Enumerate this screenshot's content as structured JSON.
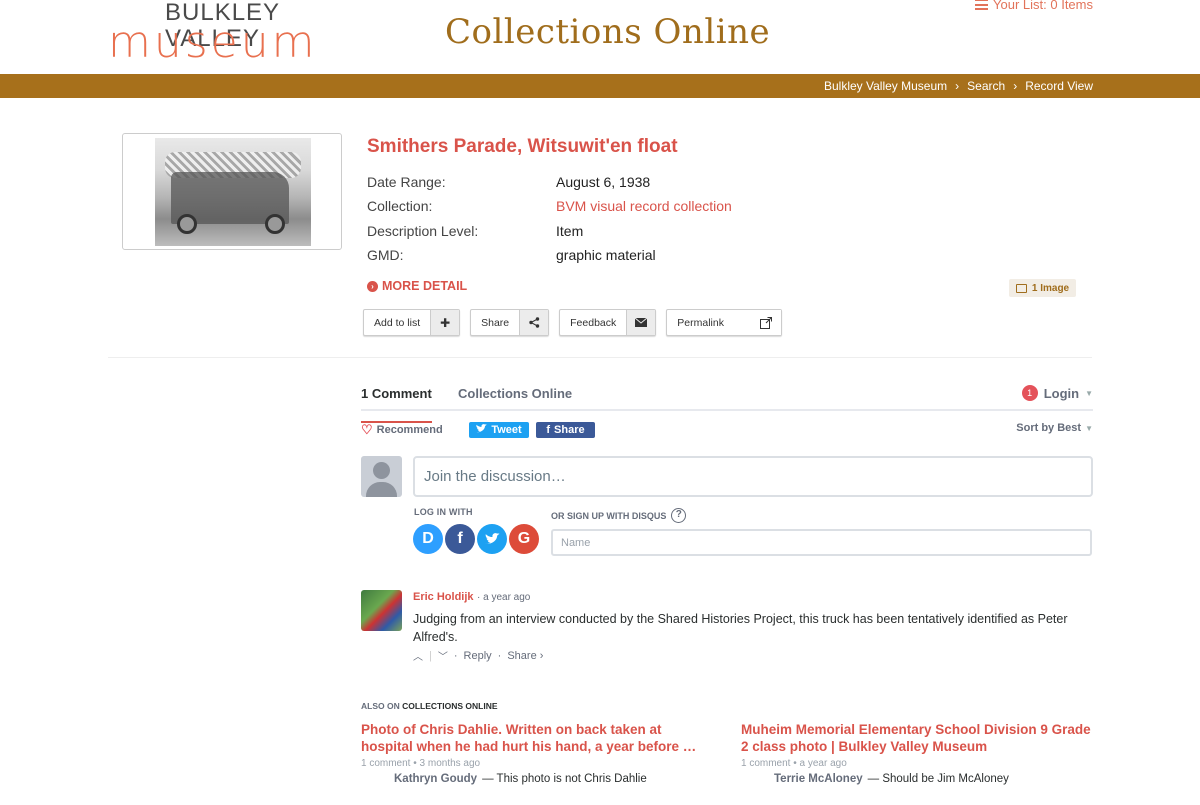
{
  "header": {
    "logo_top": "BULKLEY VALLEY",
    "logo_bottom": "museum",
    "site_title": "Collections Online",
    "your_list": "Your List:  0 Items"
  },
  "breadcrumb": {
    "items": [
      "Bulkley Valley Museum",
      "Search",
      "Record View"
    ],
    "separator": "›"
  },
  "record": {
    "title": "Smithers Parade, Witsuwit'en float",
    "fields": [
      {
        "label": "Date Range:",
        "value": "August 6, 1938"
      },
      {
        "label": "Collection:",
        "value": "BVM visual record collection"
      },
      {
        "label": "Description Level:",
        "value": "Item"
      },
      {
        "label": "GMD:",
        "value": "graphic material"
      }
    ],
    "more_detail": "MORE DETAIL",
    "image_count": "1 Image",
    "buttons": {
      "add_to_list": "Add to list",
      "share": "Share",
      "feedback": "Feedback",
      "permalink": "Permalink"
    }
  },
  "disqus": {
    "tab_comments": "1 Comment",
    "tab_forum": "Collections Online",
    "notification_count": "1",
    "login": "Login",
    "recommend": "Recommend",
    "tweet": "Tweet",
    "fb_share": "Share",
    "sort": "Sort by Best",
    "input_placeholder": "Join the discussion…",
    "login_with": "LOG IN WITH",
    "signup_label": "OR SIGN UP WITH DISQUS",
    "name_placeholder": "Name",
    "comment": {
      "author": "Eric Holdijk",
      "time": "· a year ago",
      "text": "Judging from an interview conducted by the Shared Histories Project, this truck has been tentatively identified as Peter Alfred's.",
      "reply": "Reply",
      "share": "Share ›"
    },
    "also_on_prefix": "ALSO ON",
    "also_on_site": "COLLECTIONS ONLINE",
    "related": [
      {
        "title": "Photo of Chris Dahlie. Written on back taken at hospital when he had hurt his hand, a year before …",
        "meta": "1 comment • 3 months ago",
        "who": "Kathryn Goudy",
        "snippet": "— This photo is not Chris Dahlie"
      },
      {
        "title": "Muheim Memorial Elementary School Division 9 Grade 2 class photo | Bulkley Valley Museum",
        "meta": "1 comment • a year ago",
        "who": "Terrie McAloney",
        "snippet": "— Should be Jim McAloney"
      }
    ]
  },
  "colors": {
    "brand_brown": "#a7701b",
    "accent_red": "#d9534a",
    "logo_orange": "#e8704f"
  }
}
